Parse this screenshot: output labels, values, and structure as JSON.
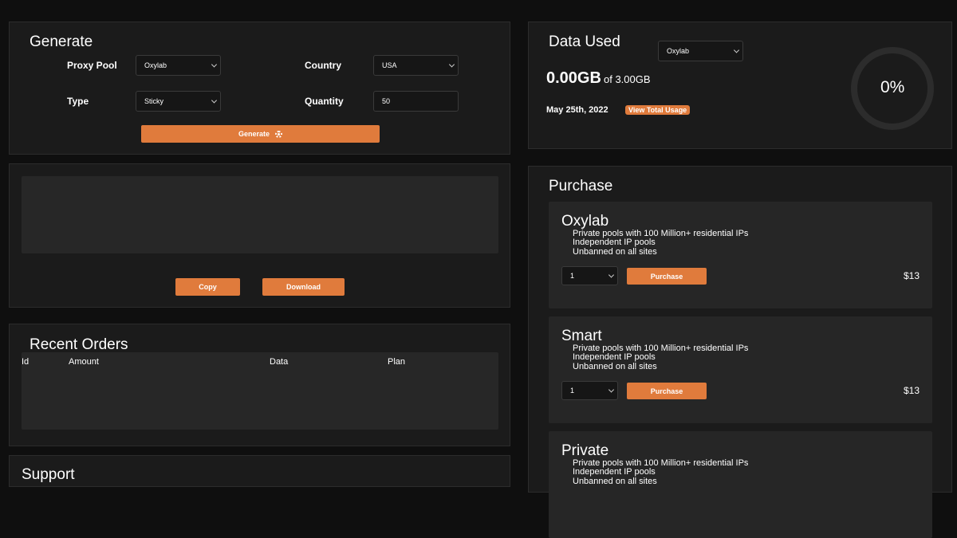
{
  "generate": {
    "title": "Generate",
    "proxy_pool_label": "Proxy Pool",
    "proxy_pool_value": "Oxylab",
    "country_label": "Country",
    "country_value": "USA",
    "type_label": "Type",
    "type_value": "Sticky",
    "quantity_label": "Quantity",
    "quantity_value": "50",
    "generate_button": "Generate"
  },
  "output": {
    "copy_button": "Copy",
    "download_button": "Download"
  },
  "recent_orders": {
    "title": "Recent Orders",
    "columns": [
      "Id",
      "Amount",
      "Data",
      "Plan"
    ]
  },
  "support": {
    "title": "Support"
  },
  "data_used": {
    "title": "Data Used",
    "pool_value": "Oxylab",
    "used": "0.00GB",
    "of_total": "of 3.00GB",
    "date": "May 25th, 2022",
    "view_usage": "View Total Usage",
    "percent_label": "0%",
    "percent_value": 0
  },
  "purchase": {
    "title": "Purchase",
    "plans": [
      {
        "name": "Oxylab",
        "features": [
          "Private pools with 100 Million+ residential IPs",
          "Independent IP pools",
          "Unbanned on all sites"
        ],
        "qty": "1",
        "button": "Purchase",
        "price": "$13"
      },
      {
        "name": "Smart",
        "features": [
          "Private pools with 100 Million+ residential IPs",
          "Independent IP pools",
          "Unbanned on all sites"
        ],
        "qty": "1",
        "button": "Purchase",
        "price": "$13"
      },
      {
        "name": "Private",
        "features": [
          "Private pools with 100 Million+ residential IPs",
          "Independent IP pools",
          "Unbanned on all sites"
        ]
      }
    ]
  },
  "colors": {
    "accent": "#e07b3c",
    "panel": "#1b1b1b",
    "background": "#0f0f0f"
  }
}
